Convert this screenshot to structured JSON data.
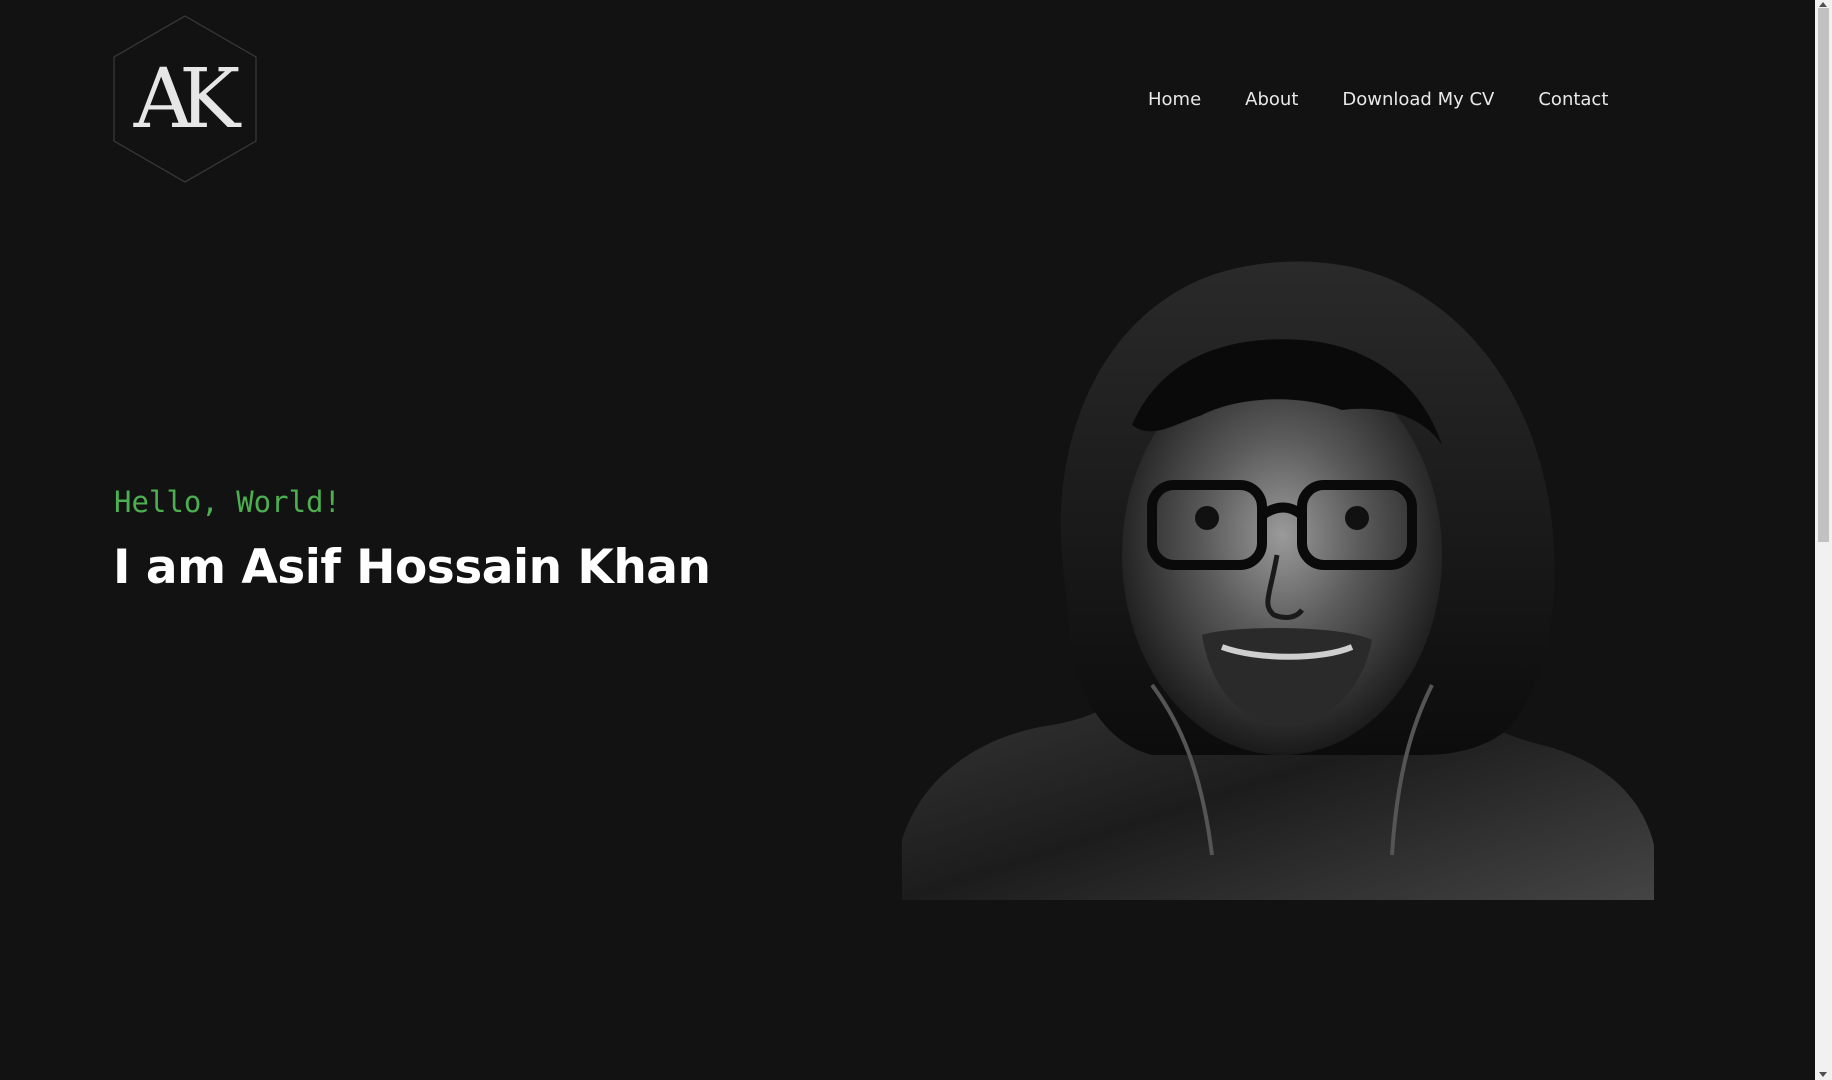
{
  "logo": {
    "text": "AK"
  },
  "nav": {
    "items": [
      {
        "label": "Home"
      },
      {
        "label": "About"
      },
      {
        "label": "Download My CV"
      },
      {
        "label": "Contact"
      }
    ]
  },
  "hero": {
    "greeting": "Hello, World!",
    "name": "I am Asif Hossain Khan"
  },
  "portrait": {
    "icon": "person-portrait-photo"
  },
  "colors": {
    "background": "#121212",
    "accent": "#4caf50",
    "text": "#ffffff",
    "nav_text": "#e8e8e8"
  }
}
